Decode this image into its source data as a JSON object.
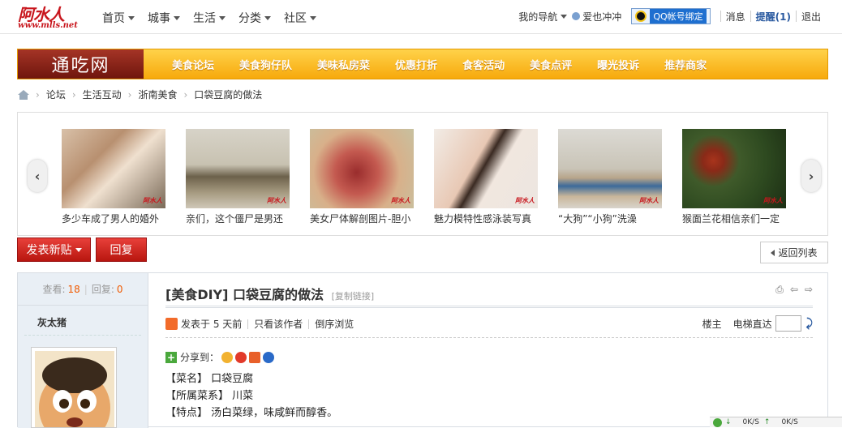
{
  "logo": {
    "main": "阿水人",
    "url": "www.mlls.net"
  },
  "topnav": [
    "首页",
    "城事",
    "生活",
    "分类",
    "社区"
  ],
  "topright": {
    "my_nav": "我的导航",
    "username": "爱也冲冲",
    "qq_bind": "QQ帐号绑定",
    "messages": "消息",
    "remind": "提醒(1)",
    "logout": "退出"
  },
  "brand": "通吃网",
  "mainnav": [
    "美食论坛",
    "美食狗仔队",
    "美味私房菜",
    "优惠打折",
    "食客活动",
    "美食点评",
    "曝光投诉",
    "推荐商家"
  ],
  "breadcrumb": [
    "论坛",
    "生活互动",
    "浙南美食",
    "口袋豆腐的做法"
  ],
  "carousel": [
    {
      "caption": "多少车成了男人的婚外"
    },
    {
      "caption": "亲们，这个僵尸是男还"
    },
    {
      "caption": "美女尸体解剖图片-胆小"
    },
    {
      "caption": "魅力模特性感泳装写真"
    },
    {
      "caption": "“大狗”“小狗”洗澡"
    },
    {
      "caption": "猴面兰花相信亲们一定"
    }
  ],
  "watermark": "阿水人",
  "buttons": {
    "post": "发表新贴",
    "reply": "回复",
    "back": "返回列表"
  },
  "stats": {
    "views_label": "查看:",
    "views": "18",
    "replies_label": "回复:",
    "replies": "0"
  },
  "author": "灰太猪",
  "post": {
    "title": "[美食DIY] 口袋豆腐的做法",
    "copy_link": "[复制链接]",
    "posted": "发表于 5 天前",
    "only_author": "只看该作者",
    "reverse": "倒序浏览",
    "floor_owner": "楼主",
    "floor_jump": "电梯直达",
    "share_label": "分享到：",
    "lines": [
      "【菜名】 口袋豆腐",
      "【所属菜系】 川菜",
      "【特点】 汤白菜绿，味咸鲜而醇香。"
    ]
  },
  "tray": {
    "down": "0K/S",
    "up": "0K/S"
  }
}
